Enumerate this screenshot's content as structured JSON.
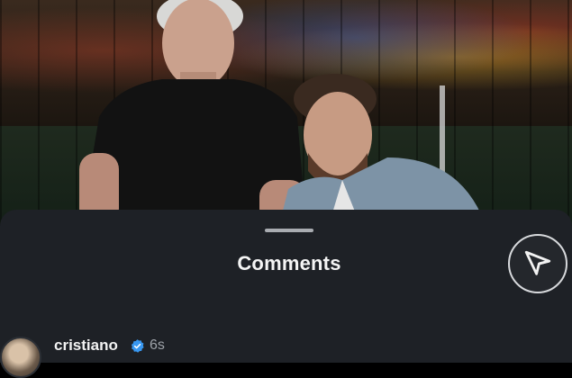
{
  "sheet": {
    "title": "Comments",
    "share_icon": "send-icon"
  },
  "comment": {
    "username": "cristiano",
    "time": "6s",
    "verified_icon": "verified-badge-icon"
  },
  "colors": {
    "sheet_bg": "#1e2126",
    "verified_blue": "#3897f0"
  }
}
